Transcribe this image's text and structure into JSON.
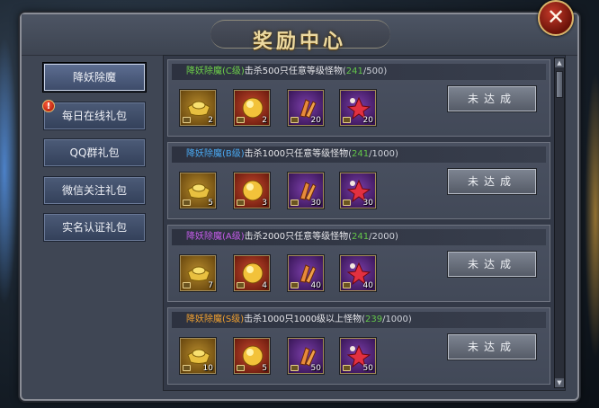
{
  "window": {
    "title": "奖励中心",
    "close_label": "✕"
  },
  "tabs": [
    {
      "label": "降妖除魔",
      "active": true,
      "alert": false
    },
    {
      "label": "每日在线礼包",
      "active": false,
      "alert": true
    },
    {
      "label": "QQ群礼包",
      "active": false,
      "alert": false
    },
    {
      "label": "微信关注礼包",
      "active": false,
      "alert": false
    },
    {
      "label": "实名认证礼包",
      "active": false,
      "alert": false
    }
  ],
  "tab_alert_glyph": "!",
  "entries": [
    {
      "name": "降妖除魔",
      "rank": "(C级)",
      "rank_color": "#6ed14a",
      "task": "击杀500只任意等级怪物",
      "current": "241",
      "target": "500",
      "button": "未达成",
      "items": [
        {
          "icon": "gold-ingot-icon",
          "count": "2"
        },
        {
          "icon": "gold-orb-icon",
          "count": "2"
        },
        {
          "icon": "claw-scroll-icon",
          "count": "20"
        },
        {
          "icon": "red-flower-icon",
          "count": "20"
        }
      ]
    },
    {
      "name": "降妖除魔",
      "rank": "(B级)",
      "rank_color": "#4aa8f0",
      "task": "击杀1000只任意等级怪物",
      "current": "241",
      "target": "1000",
      "button": "未达成",
      "items": [
        {
          "icon": "gold-ingot-icon",
          "count": "5"
        },
        {
          "icon": "gold-orb-icon",
          "count": "3"
        },
        {
          "icon": "claw-scroll-icon",
          "count": "30"
        },
        {
          "icon": "red-flower-icon",
          "count": "30"
        }
      ]
    },
    {
      "name": "降妖除魔",
      "rank": "(A级)",
      "rank_color": "#c35be8",
      "task": "击杀2000只任意等级怪物",
      "current": "241",
      "target": "2000",
      "button": "未达成",
      "items": [
        {
          "icon": "gold-ingot-icon",
          "count": "7"
        },
        {
          "icon": "gold-orb-icon",
          "count": "4"
        },
        {
          "icon": "claw-scroll-icon",
          "count": "40"
        },
        {
          "icon": "red-flower-icon",
          "count": "40"
        }
      ]
    },
    {
      "name": "降妖除魔",
      "rank": "(S级)",
      "rank_color": "#f0a030",
      "task": "击杀1000只1000级以上怪物",
      "current": "239",
      "target": "1000",
      "button": "未达成",
      "items": [
        {
          "icon": "gold-ingot-icon",
          "count": "10"
        },
        {
          "icon": "gold-orb-icon",
          "count": "5"
        },
        {
          "icon": "claw-scroll-icon",
          "count": "50"
        },
        {
          "icon": "red-flower-icon",
          "count": "50"
        }
      ]
    }
  ],
  "scrollbar": {
    "up": "▲",
    "down": "▼"
  }
}
